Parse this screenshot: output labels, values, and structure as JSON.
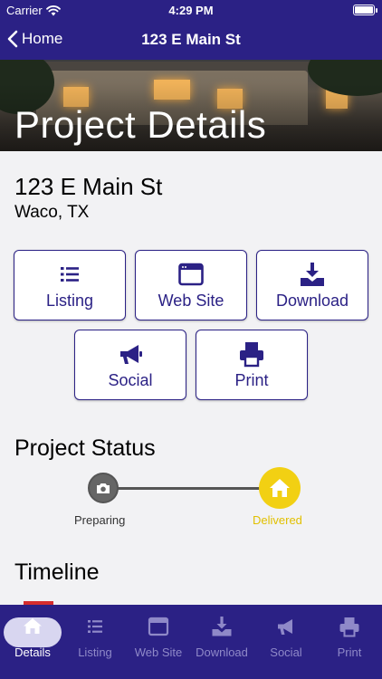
{
  "status_bar": {
    "carrier": "Carrier",
    "time": "4:29 PM"
  },
  "nav": {
    "back_label": "Home",
    "title": "123 E Main St"
  },
  "hero": {
    "title": "Project Details"
  },
  "property": {
    "address": "123 E Main St",
    "city": "Waco, TX"
  },
  "actions": [
    {
      "label": "Listing",
      "icon": "list-icon"
    },
    {
      "label": "Web Site",
      "icon": "browser-window-icon"
    },
    {
      "label": "Download",
      "icon": "download-icon"
    },
    {
      "label": "Social",
      "icon": "megaphone-icon"
    },
    {
      "label": "Print",
      "icon": "printer-icon"
    }
  ],
  "project_status": {
    "heading": "Project Status",
    "steps": [
      {
        "label": "Preparing",
        "icon": "camera-icon",
        "color": "#555555"
      },
      {
        "label": "Delivered",
        "icon": "home-icon",
        "color": "#f2d013"
      }
    ]
  },
  "timeline": {
    "heading": "Timeline"
  },
  "tabs": [
    {
      "label": "Details",
      "icon": "home-icon",
      "active": true
    },
    {
      "label": "Listing",
      "icon": "list-icon",
      "active": false
    },
    {
      "label": "Web Site",
      "icon": "browser-window-icon",
      "active": false
    },
    {
      "label": "Download",
      "icon": "download-icon",
      "active": false
    },
    {
      "label": "Social",
      "icon": "megaphone-icon",
      "active": false
    },
    {
      "label": "Print",
      "icon": "printer-icon",
      "active": false
    }
  ],
  "colors": {
    "primary": "#2b2185",
    "accent": "#f2d013",
    "tab_inactive": "#8f89c8",
    "background": "#f2f2f4"
  }
}
